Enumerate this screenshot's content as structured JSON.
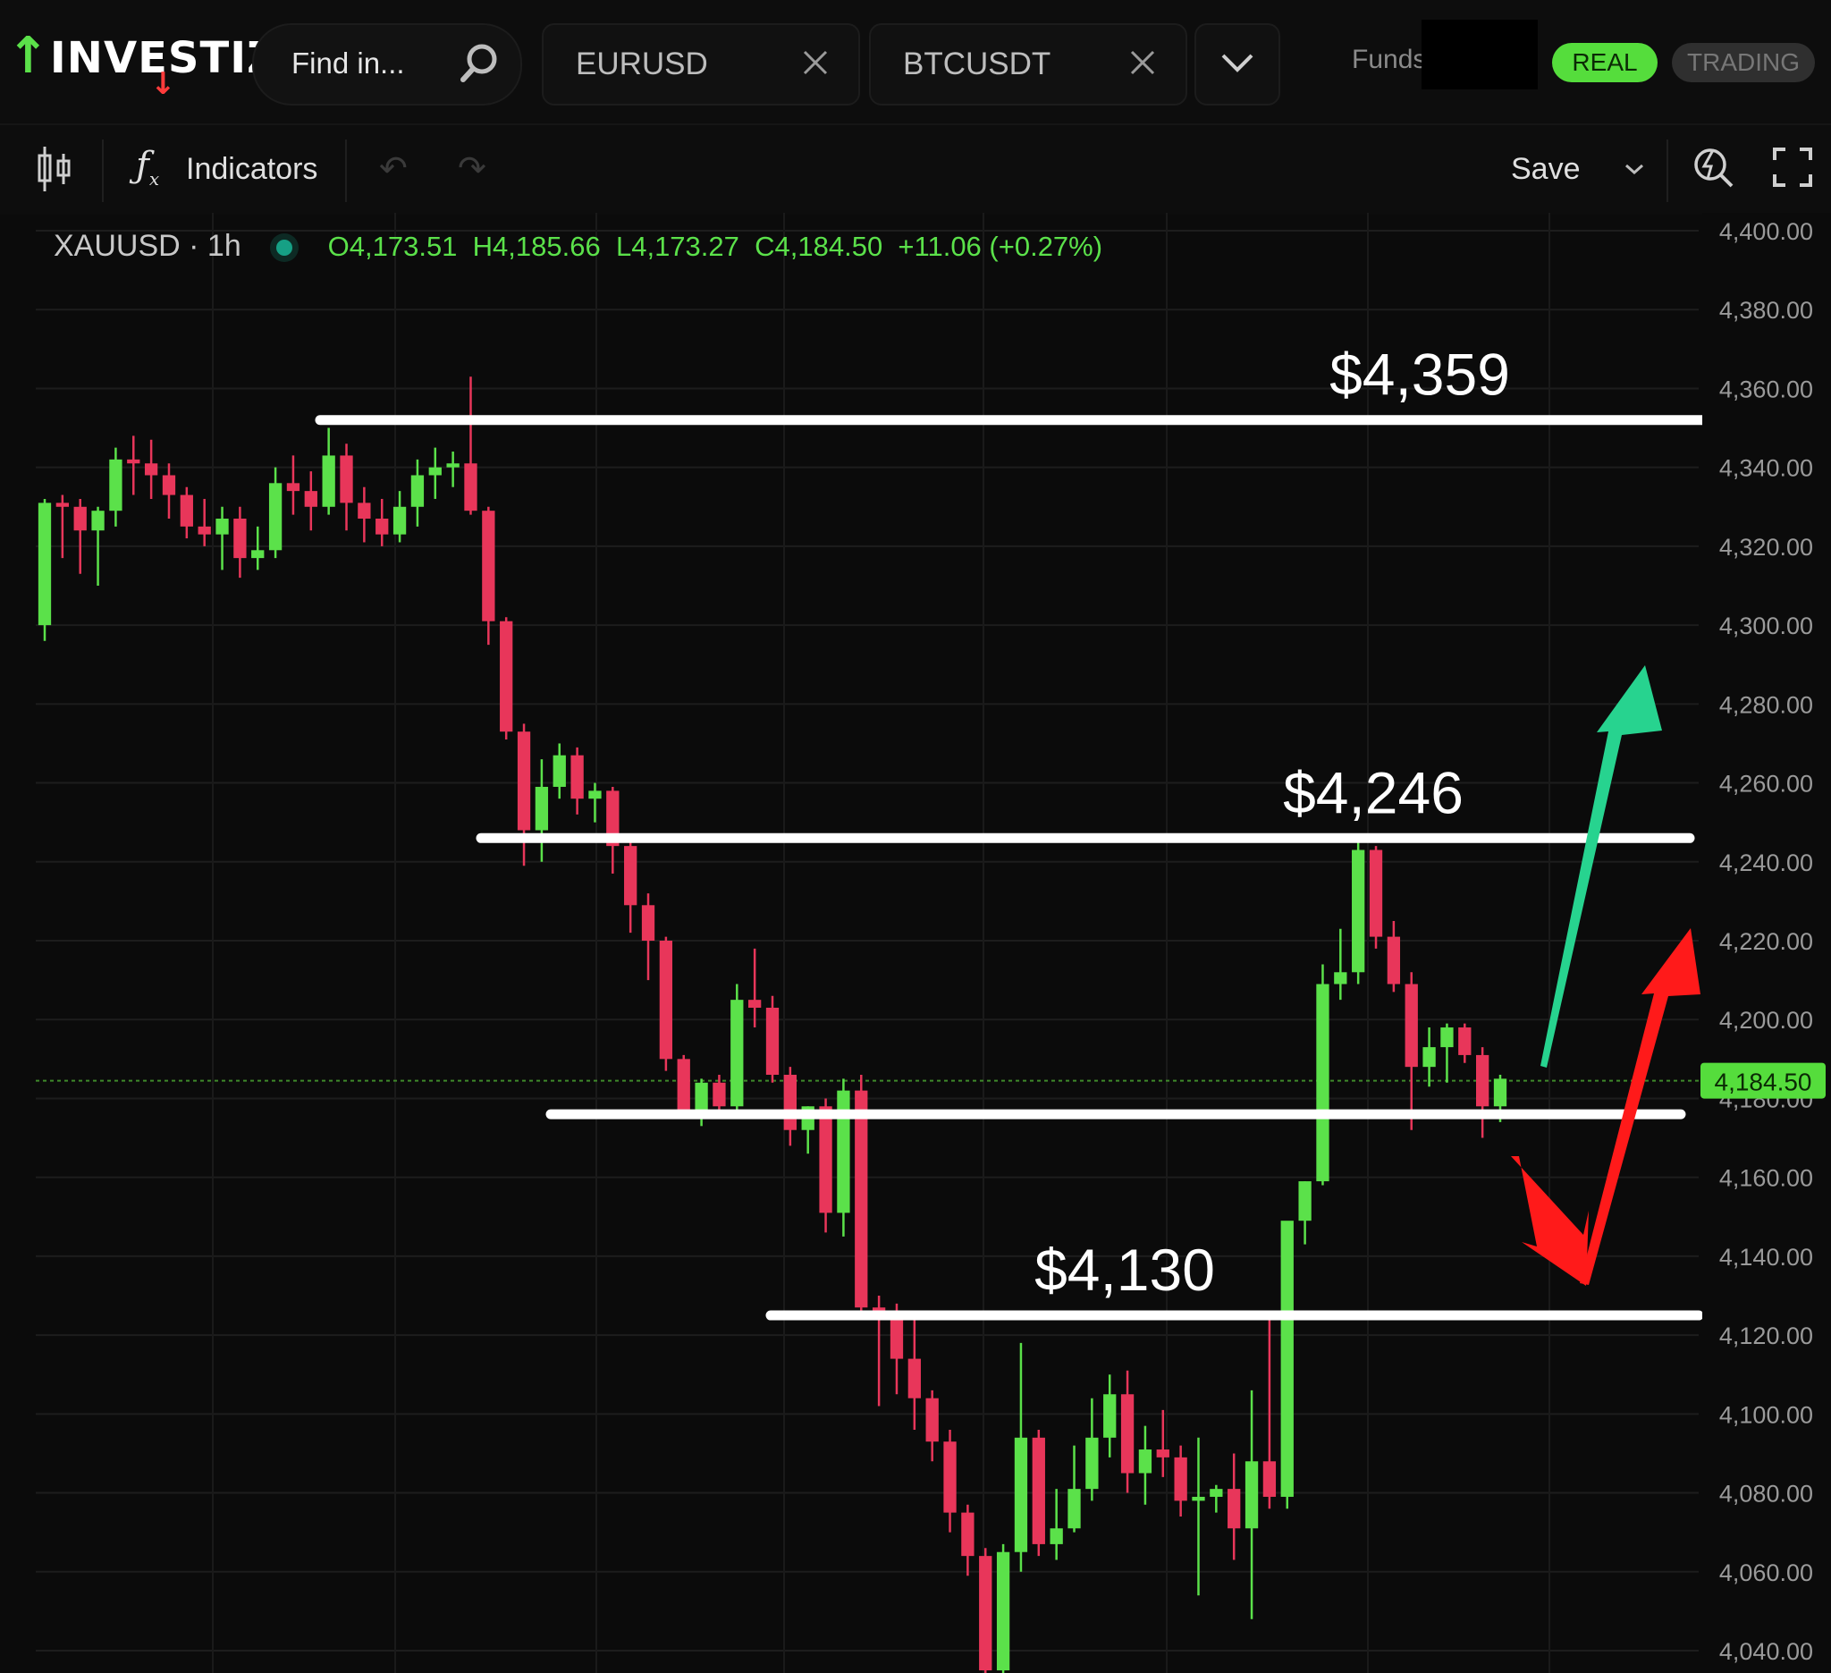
{
  "brand": {
    "logo_text": "INVESTIZO"
  },
  "header": {
    "search_placeholder": "Find in...",
    "tabs": [
      {
        "label": "EURUSD"
      },
      {
        "label": "BTCUSDT"
      }
    ],
    "funds_label": "Funds",
    "account_modes": [
      "REAL",
      "TRADING"
    ]
  },
  "toolbar": {
    "indicators_label": "Indicators",
    "save_label": "Save"
  },
  "chart_header": {
    "symbol": "XAUUSD · 1h",
    "open": "O4,173.51",
    "high": "H4,185.66",
    "low": "L4,173.27",
    "close": "C4,184.50",
    "change": "+11.06 (+0.27%)"
  },
  "colors": {
    "up": "#5be14a",
    "down": "#e8365a",
    "accent_green": "#27d38f",
    "accent_red": "#ff1a1a",
    "background": "#0b0b0b"
  },
  "chart_data": {
    "type": "candlestick",
    "symbol": "XAUUSD",
    "timeframe": "1h",
    "ylim": [
      4040,
      4400
    ],
    "y_ticks": [
      "4,400.00",
      "4,380.00",
      "4,360.00",
      "4,340.00",
      "4,320.00",
      "4,300.00",
      "4,280.00",
      "4,260.00",
      "4,240.00",
      "4,220.00",
      "4,200.00",
      "4,180.00",
      "4,160.00",
      "4,140.00",
      "4,120.00",
      "4,100.00",
      "4,080.00",
      "4,060.00",
      "4,040.00"
    ],
    "last_price": "4,184.50",
    "candles": [
      [
        4300,
        4332,
        4296,
        4331
      ],
      [
        4331,
        4333,
        4317,
        4330
      ],
      [
        4330,
        4332,
        4313,
        4324
      ],
      [
        4324,
        4330,
        4310,
        4329
      ],
      [
        4329,
        4345,
        4325,
        4342
      ],
      [
        4342,
        4348,
        4333,
        4341
      ],
      [
        4341,
        4347,
        4332,
        4338
      ],
      [
        4338,
        4341,
        4327,
        4333
      ],
      [
        4333,
        4335,
        4322,
        4325
      ],
      [
        4325,
        4332,
        4320,
        4323
      ],
      [
        4323,
        4330,
        4314,
        4327
      ],
      [
        4327,
        4330,
        4312,
        4317
      ],
      [
        4317,
        4325,
        4314,
        4319
      ],
      [
        4319,
        4340,
        4317,
        4336
      ],
      [
        4336,
        4343,
        4328,
        4334
      ],
      [
        4334,
        4339,
        4324,
        4330
      ],
      [
        4330,
        4350,
        4328,
        4343
      ],
      [
        4343,
        4346,
        4324,
        4331
      ],
      [
        4331,
        4335,
        4321,
        4327
      ],
      [
        4327,
        4332,
        4320,
        4323
      ],
      [
        4323,
        4334,
        4321,
        4330
      ],
      [
        4330,
        4342,
        4325,
        4338
      ],
      [
        4338,
        4345,
        4332,
        4340
      ],
      [
        4340,
        4344,
        4335,
        4341
      ],
      [
        4341,
        4363,
        4328,
        4329
      ],
      [
        4329,
        4330,
        4295,
        4301
      ],
      [
        4301,
        4302,
        4271,
        4273
      ],
      [
        4273,
        4275,
        4239,
        4248
      ],
      [
        4248,
        4266,
        4240,
        4259
      ],
      [
        4259,
        4270,
        4256,
        4267
      ],
      [
        4267,
        4269,
        4252,
        4256
      ],
      [
        4256,
        4260,
        4250,
        4258
      ],
      [
        4258,
        4259,
        4237,
        4244
      ],
      [
        4244,
        4245,
        4222,
        4229
      ],
      [
        4229,
        4232,
        4210,
        4220
      ],
      [
        4220,
        4221,
        4187,
        4190
      ],
      [
        4190,
        4191,
        4175,
        4177
      ],
      [
        4177,
        4185,
        4173,
        4184
      ],
      [
        4184,
        4186,
        4176,
        4178
      ],
      [
        4178,
        4209,
        4176,
        4205
      ],
      [
        4205,
        4218,
        4198,
        4203
      ],
      [
        4203,
        4206,
        4184,
        4186
      ],
      [
        4186,
        4188,
        4168,
        4172
      ],
      [
        4172,
        4178,
        4166,
        4178
      ],
      [
        4178,
        4180,
        4146,
        4151
      ],
      [
        4151,
        4185,
        4145,
        4182
      ],
      [
        4182,
        4186,
        4124,
        4127
      ],
      [
        4127,
        4130,
        4102,
        4126
      ],
      [
        4126,
        4128,
        4105,
        4114
      ],
      [
        4114,
        4124,
        4096,
        4104
      ],
      [
        4104,
        4106,
        4088,
        4093
      ],
      [
        4093,
        4096,
        4070,
        4075
      ],
      [
        4075,
        4077,
        4059,
        4064
      ],
      [
        4064,
        4066,
        4034,
        4035
      ],
      [
        4035,
        4067,
        4034,
        4065
      ],
      [
        4065,
        4118,
        4060,
        4094
      ],
      [
        4094,
        4096,
        4064,
        4067
      ],
      [
        4067,
        4081,
        4063,
        4071
      ],
      [
        4071,
        4092,
        4070,
        4081
      ],
      [
        4081,
        4104,
        4078,
        4094
      ],
      [
        4094,
        4110,
        4089,
        4105
      ],
      [
        4105,
        4111,
        4080,
        4085
      ],
      [
        4085,
        4097,
        4077,
        4091
      ],
      [
        4091,
        4101,
        4084,
        4089
      ],
      [
        4089,
        4092,
        4074,
        4078
      ],
      [
        4078,
        4094,
        4054,
        4079
      ],
      [
        4079,
        4082,
        4075,
        4081
      ],
      [
        4081,
        4090,
        4063,
        4071
      ],
      [
        4071,
        4106,
        4048,
        4088
      ],
      [
        4088,
        4126,
        4076,
        4079
      ],
      [
        4079,
        4147,
        4076,
        4149
      ],
      [
        4149,
        4159,
        4143,
        4159
      ],
      [
        4159,
        4214,
        4158,
        4209
      ],
      [
        4209,
        4223,
        4205,
        4212
      ],
      [
        4212,
        4246,
        4209,
        4243
      ],
      [
        4243,
        4244,
        4218,
        4221
      ],
      [
        4221,
        4225,
        4207,
        4209
      ],
      [
        4209,
        4212,
        4172,
        4188
      ],
      [
        4188,
        4198,
        4183,
        4193
      ],
      [
        4193,
        4199,
        4184,
        4198
      ],
      [
        4198,
        4199,
        4189,
        4191
      ],
      [
        4191,
        4193,
        4170,
        4178
      ],
      [
        4178,
        4186,
        4174,
        4185
      ]
    ],
    "levels": [
      {
        "price": 4352,
        "label": "$4,359"
      },
      {
        "price": 4246,
        "label": "$4,246"
      },
      {
        "price": 4176,
        "label": ""
      },
      {
        "price": 4125,
        "label": "$4,130"
      }
    ]
  }
}
